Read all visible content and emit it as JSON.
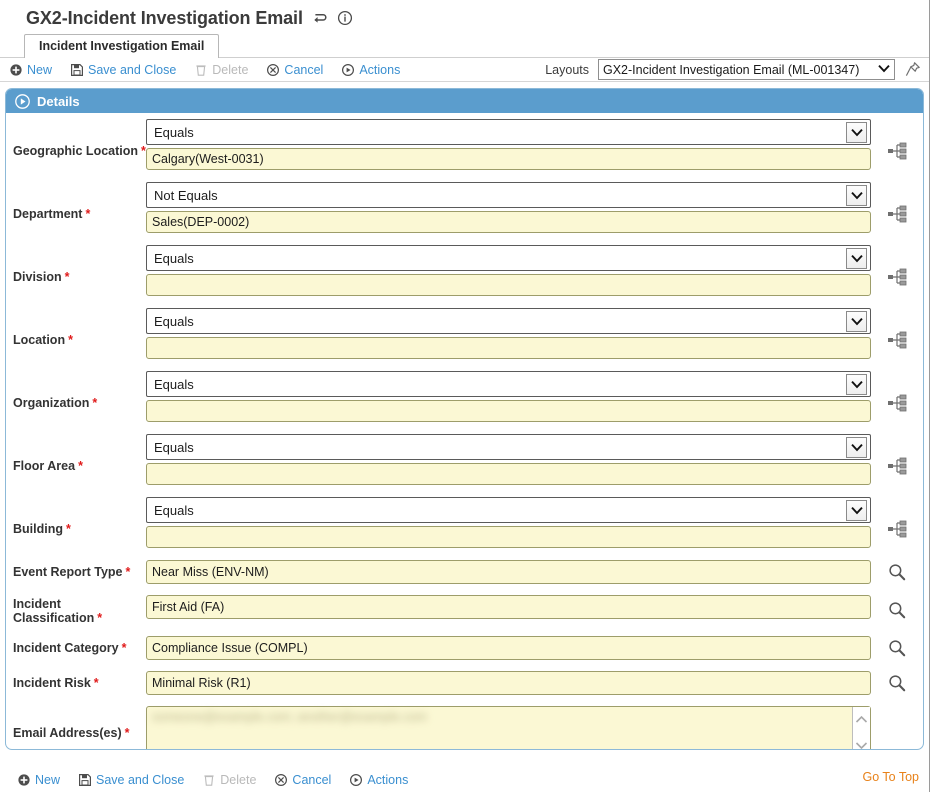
{
  "header": {
    "title": "GX2-Incident Investigation Email",
    "refresh_icon": "refresh-icon",
    "info_icon": "info-icon"
  },
  "tab": {
    "label": "Incident Investigation Email"
  },
  "toolbar": {
    "new_label": "New",
    "save_and_close_label": "Save and Close",
    "delete_label": "Delete",
    "cancel_label": "Cancel",
    "actions_label": "Actions",
    "layouts_label": "Layouts",
    "layout_selected": "GX2-Incident Investigation Email (ML-001347)",
    "pin_icon": "pin-icon"
  },
  "panel": {
    "title": "Details",
    "collapse_icon": "play-triangle-icon"
  },
  "fields": [
    {
      "label": "Geographic Location",
      "required": "*",
      "operator": "Equals",
      "value": "Calgary(West-0031)",
      "picker_icon": "hierarchy-picker-icon"
    },
    {
      "label": "Department",
      "required": "*",
      "operator": "Not Equals",
      "value": "Sales(DEP-0002)",
      "picker_icon": "hierarchy-picker-icon"
    },
    {
      "label": "Division",
      "required": "*",
      "operator": "Equals",
      "value": "",
      "picker_icon": "hierarchy-picker-icon"
    },
    {
      "label": "Location",
      "required": "*",
      "operator": "Equals",
      "value": "",
      "picker_icon": "hierarchy-picker-icon"
    },
    {
      "label": "Organization",
      "required": "*",
      "operator": "Equals",
      "value": "",
      "picker_icon": "hierarchy-picker-icon"
    },
    {
      "label": "Floor Area",
      "required": "*",
      "operator": "Equals",
      "value": "",
      "picker_icon": "hierarchy-picker-icon"
    },
    {
      "label": "Building",
      "required": "*",
      "operator": "Equals",
      "value": "",
      "picker_icon": "hierarchy-picker-icon"
    }
  ],
  "lookup_fields": [
    {
      "label": "Event Report Type",
      "required": "*",
      "value": "Near Miss (ENV-NM)",
      "picker_icon": "search-icon"
    },
    {
      "label": "Incident Classification",
      "required": "*",
      "value": "First Aid (FA)",
      "picker_icon": "search-icon"
    },
    {
      "label": "Incident Category",
      "required": "*",
      "value": "Compliance Issue (COMPL)",
      "picker_icon": "search-icon"
    },
    {
      "label": "Incident Risk",
      "required": "*",
      "value": "Minimal Risk (R1)",
      "picker_icon": "search-icon"
    }
  ],
  "email_field": {
    "label": "Email Address(es)",
    "required": "*",
    "value": "",
    "redacted": true
  },
  "footer": {
    "new_label": "New",
    "save_and_close_label": "Save and Close",
    "delete_label": "Delete",
    "cancel_label": "Cancel",
    "actions_label": "Actions",
    "go_to_top_label": "Go To Top"
  },
  "colors": {
    "accent_blue": "#5b9dcd",
    "link_blue": "#3a8fd0",
    "field_yellow": "#fbf8d4",
    "required_red": "#e01b1b",
    "gototop_orange": "#e8821a"
  }
}
